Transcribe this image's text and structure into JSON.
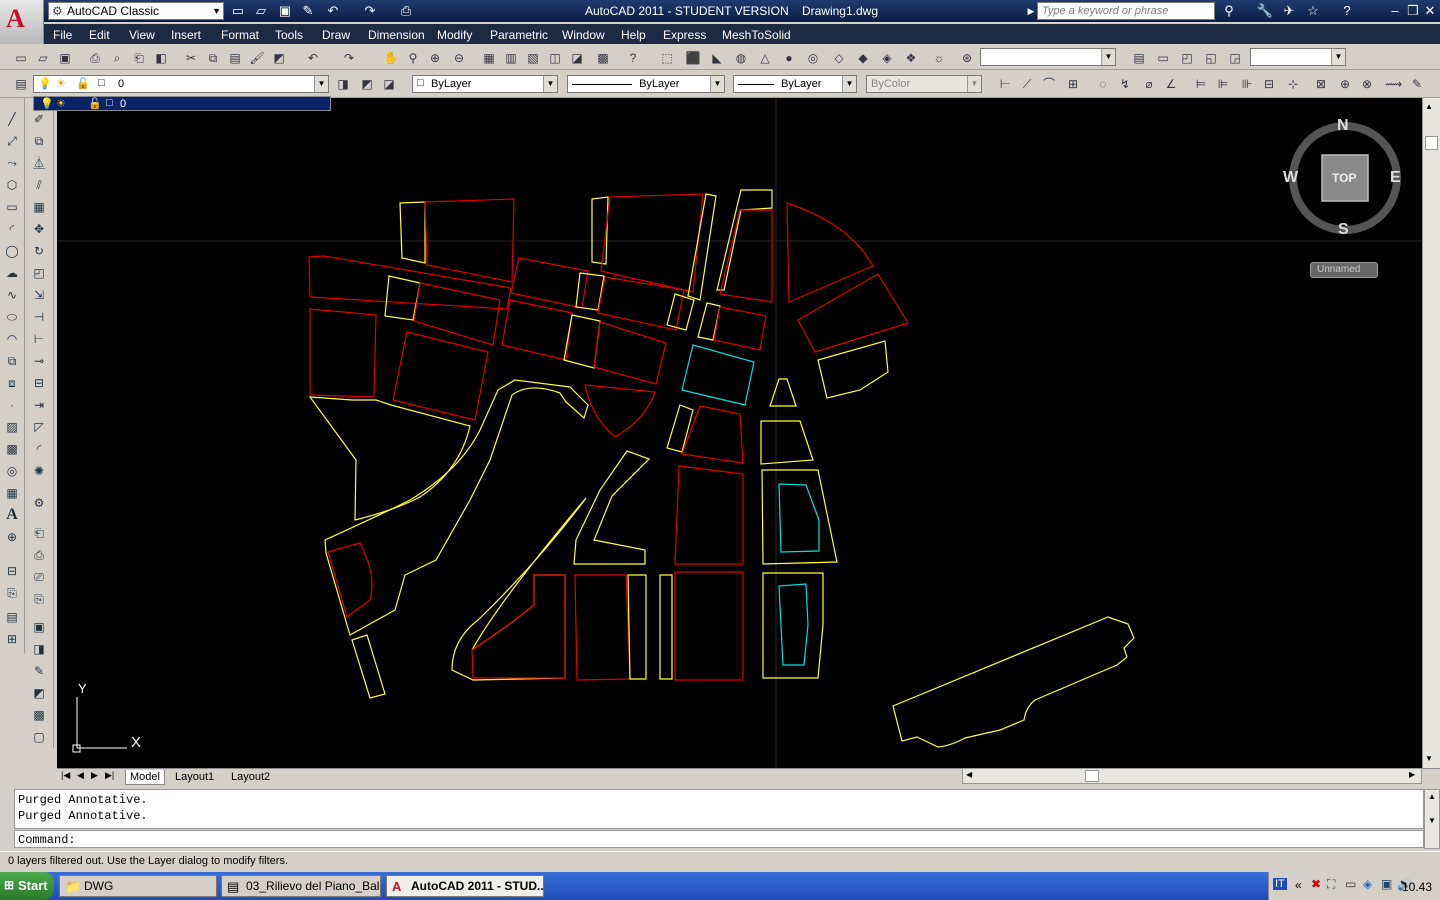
{
  "app": {
    "title": "AutoCAD 2011 - STUDENT VERSION    Drawing1.dwg",
    "workspace": "AutoCAD Classic",
    "search_placeholder": "Type a keyword or phrase"
  },
  "menu": [
    "File",
    "Edit",
    "View",
    "Insert",
    "Format",
    "Tools",
    "Draw",
    "Dimension",
    "Modify",
    "Parametric",
    "Window",
    "Help",
    "Express",
    "MeshToSolid"
  ],
  "layers_toolbar": {
    "current_layer": "0",
    "layer_dropdown_value": "0",
    "color": "ByLayer",
    "linetype": "ByLayer",
    "lineweight": "ByLayer",
    "plotstyle": "ByColor"
  },
  "viewcube": {
    "north": "N",
    "south": "S",
    "east": "E",
    "west": "W",
    "face": "TOP",
    "ucs": "Unnamed"
  },
  "ucs_icon": {
    "x": "X",
    "y": "Y"
  },
  "tabs": [
    "Model",
    "Layout1",
    "Layout2"
  ],
  "command": {
    "history": [
      "Purged Annotative.",
      "Purged Annotative."
    ],
    "prompt": "Command:"
  },
  "status_text": "0 layers filtered out.  Use the Layer dialog to modify filters.",
  "taskbar": {
    "start": "Start",
    "tasks": [
      "DWG",
      "03_Rilievo del Piano_Ball...",
      "AutoCAD 2011 - STUD..."
    ],
    "language": "IT",
    "clock": "10.43"
  },
  "colors": {
    "canvas": "#000000",
    "red": "#e00000",
    "yellow": "#ffff33",
    "cyan": "#00e0e0",
    "title": "#1f3b6e"
  }
}
